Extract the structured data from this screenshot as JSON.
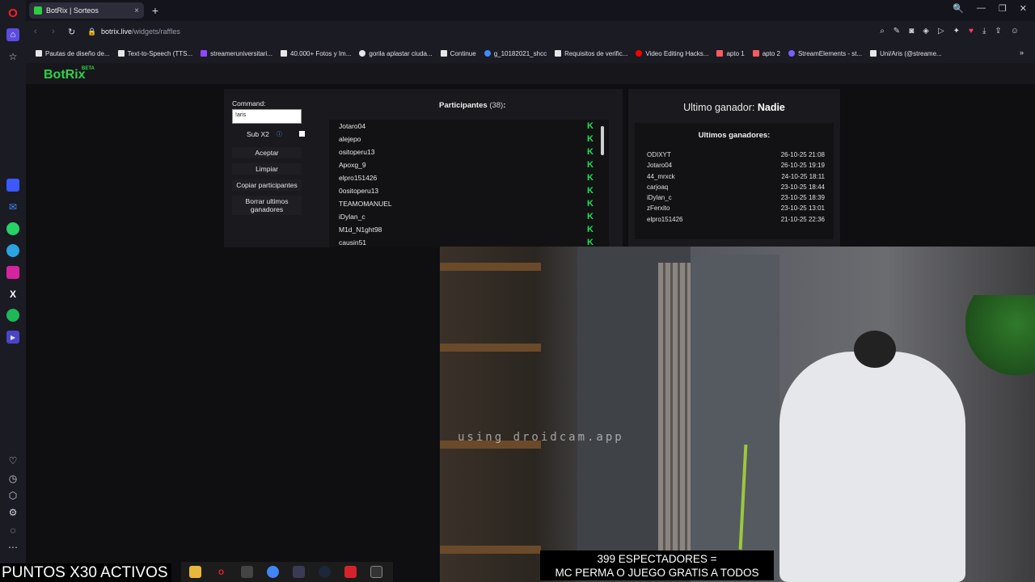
{
  "browser": {
    "tab_title": "BotRix | Sorteos",
    "tab_close": "×",
    "new_tab": "+",
    "url_domain": "botrix.live",
    "url_path": "/widgets/raffles",
    "window_controls": [
      "🔍",
      "—",
      "❐",
      "✕"
    ],
    "bookmarks": [
      "Pautas de diseño de...",
      "Text-to-Speech (TTS...",
      "streameruniversitari...",
      "40.000+ Fotos y Im...",
      "gorila aplastar ciuda...",
      "Continue",
      "g_10182021_shcc",
      "Requisitos de verific...",
      "Video Editing Hacks...",
      "apto 1",
      "apto 2",
      "StreamElements - st...",
      "Uni/Aris (@streame..."
    ],
    "bookmarks_more": "»"
  },
  "botrix": {
    "logo": "BotRix",
    "beta": "BETA"
  },
  "raffle": {
    "command_label": "Command:",
    "command_value": "!aris",
    "subx2_label": "Sub X2",
    "accept_label": "Aceptar",
    "clear_label": "Limpiar",
    "copy_label": "Copiar participantes",
    "delete_winners_label": "Borrar ultimos ganadores",
    "participants_title": "Participantes",
    "participants_count": "(38)",
    "participants_colon": ":",
    "participants": [
      "Jotaro04",
      "alejepo",
      "ositoperu13",
      "Apoxg_9",
      "elpro151426",
      "0ositoperu13",
      "TEAMOMANUEL",
      "iDylan_c",
      "M1d_N1ght98",
      "causin51"
    ]
  },
  "winners": {
    "last_winner_label": "Ultimo ganador:",
    "last_winner_value": "Nadie",
    "title": "Ultimos ganadores:",
    "rows": [
      {
        "name": "ODIXYT",
        "date": "26-10-25 21:08"
      },
      {
        "name": "Jotaro04",
        "date": "26-10-25 19:19"
      },
      {
        "name": "44_mrxck",
        "date": "24-10-25 18:11"
      },
      {
        "name": "carjoaq",
        "date": "23-10-25 18:44"
      },
      {
        "name": "iDylan_c",
        "date": "23-10-25 18:39"
      },
      {
        "name": "zFerxito",
        "date": "23-10-25 13:01"
      },
      {
        "name": "elpro151426",
        "date": "21-10-25 22:36"
      }
    ]
  },
  "stream": {
    "puntos": "PUNTOS X30 ACTIVOS",
    "specs_line1": "399 ESPECTADORES =",
    "specs_line2": "MC PERMA O JUEGO GRATIS A TODOS",
    "webcam_watermark": "using droidcam.app"
  },
  "colors": {
    "botrix_green": "#2fd14a",
    "k_green": "#1ee052",
    "opera_red": "#ff1b2d"
  }
}
